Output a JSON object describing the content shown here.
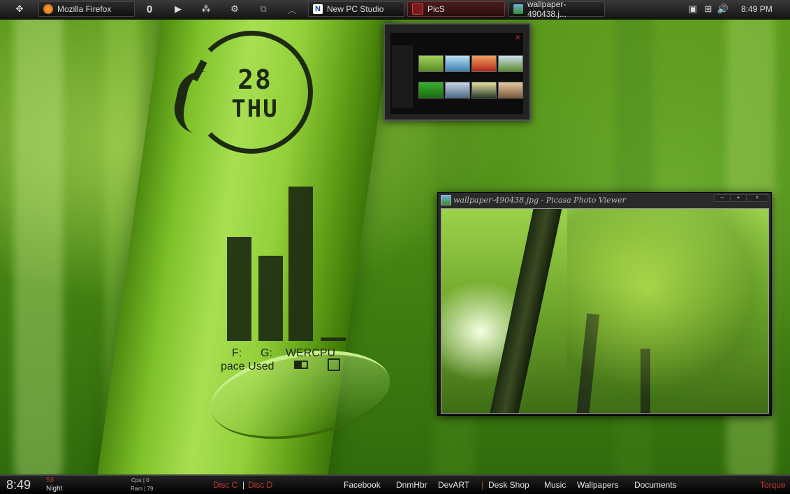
{
  "taskbar": {
    "start_icon": "diamond-arrows-icon",
    "tasks": [
      {
        "label": "Mozilla Firefox",
        "icon": "firefox-icon"
      },
      {
        "label": "New PC Studio",
        "icon": "n-app-icon"
      },
      {
        "label": "PicS",
        "icon": "pics-icon"
      },
      {
        "label": "wallpaper-490438.j...",
        "icon": "image-icon"
      }
    ],
    "quick_launch": [
      "0",
      "▶",
      "⁂",
      "⚙",
      "⧉",
      "︿"
    ],
    "clock": "8:49 PM"
  },
  "clock_widget": {
    "day": "28",
    "weekday": "THU"
  },
  "drive_widget": {
    "bars": [
      {
        "label": "F:",
        "level": 0.55
      },
      {
        "label": "G:",
        "level": 0.45
      },
      {
        "label": "POWER",
        "level": 0.82
      },
      {
        "label": "CPU",
        "level": 0.02
      }
    ],
    "visible_labels": [
      "F:",
      "G:",
      "WERCPU"
    ],
    "caption": "pace Used"
  },
  "viewer": {
    "title": "wallpaper-490438.jpg - Picasa Photo Viewer",
    "buttons": [
      "–",
      "+",
      "×"
    ]
  },
  "bottombar": {
    "time": "8:49",
    "weather_temp": "53",
    "weather_label": "Night",
    "cpu": "Cpu | 0",
    "ram": "Ram | 79",
    "disc_c": "Disc C",
    "separator": "|",
    "disc_d": "Disc D",
    "links": [
      "Facebook",
      "DnmHbr",
      "DevART",
      "Desk Shop",
      "Music",
      "Wallpapers",
      "Documents"
    ],
    "right": "Torque"
  },
  "colors": {
    "accent_red": "#c23a30",
    "widget_dark": "#1d2a10"
  }
}
